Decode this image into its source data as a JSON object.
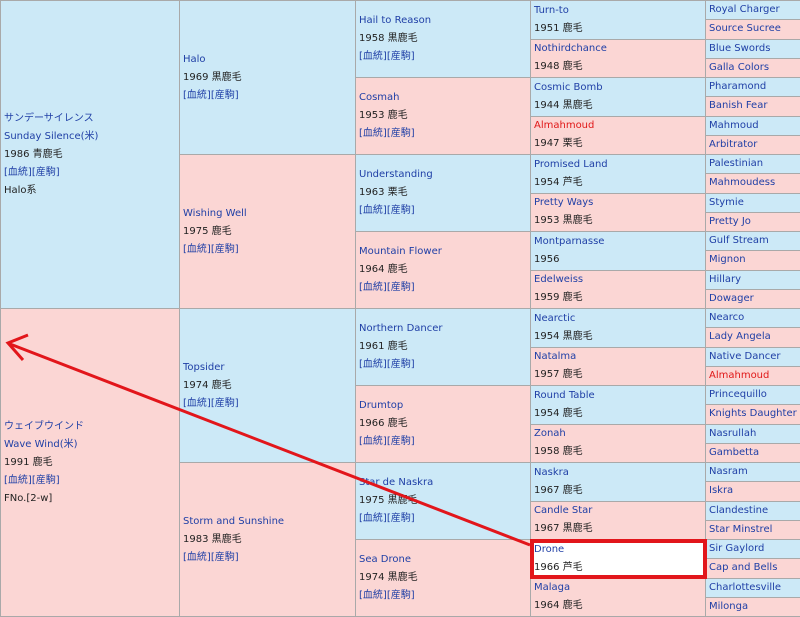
{
  "gen1": [
    {
      "jp": "サンデーサイレンス",
      "en": "Sunday Silence(米)",
      "year": "1986 青鹿毛",
      "links": [
        "[血統]",
        "[産駒]"
      ],
      "extra": "Halo系"
    },
    {
      "jp": "ウェイブウインド",
      "en": "Wave Wind(米)",
      "year": "1991 鹿毛",
      "links": [
        "[血統]",
        "[産駒]"
      ],
      "extra": "FNo.[2-w]"
    }
  ],
  "gen2": [
    {
      "name": "Halo",
      "year": "1969 黒鹿毛",
      "links": [
        "[血統]",
        "[産駒]"
      ]
    },
    {
      "name": "Wishing Well",
      "year": "1975 鹿毛",
      "links": [
        "[血統]",
        "[産駒]"
      ]
    },
    {
      "name": "Topsider",
      "year": "1974 鹿毛",
      "links": [
        "[血統]",
        "[産駒]"
      ]
    },
    {
      "name": "Storm and Sunshine",
      "year": "1983 黒鹿毛",
      "links": [
        "[血統]",
        "[産駒]"
      ]
    }
  ],
  "gen3": [
    {
      "name": "Hail to Reason",
      "year": "1958 黒鹿毛",
      "links": [
        "[血統]",
        "[産駒]"
      ]
    },
    {
      "name": "Cosmah",
      "year": "1953 鹿毛",
      "links": [
        "[血統]",
        "[産駒]"
      ]
    },
    {
      "name": "Understanding",
      "year": "1963 栗毛",
      "links": [
        "[血統]",
        "[産駒]"
      ]
    },
    {
      "name": "Mountain Flower",
      "year": "1964 鹿毛",
      "links": [
        "[血統]",
        "[産駒]"
      ]
    },
    {
      "name": "Northern Dancer",
      "year": "1961 鹿毛",
      "links": [
        "[血統]",
        "[産駒]"
      ]
    },
    {
      "name": "Drumtop",
      "year": "1966 鹿毛",
      "links": [
        "[血統]",
        "[産駒]"
      ]
    },
    {
      "name": "Star de Naskra",
      "year": "1975 黒鹿毛",
      "links": [
        "[血統]",
        "[産駒]"
      ]
    },
    {
      "name": "Sea Drone",
      "year": "1974 黒鹿毛",
      "links": [
        "[血統]",
        "[産駒]"
      ]
    }
  ],
  "gen4": [
    {
      "name": "Turn-to",
      "year": "1951 鹿毛"
    },
    {
      "name": "Nothirdchance",
      "year": "1948 鹿毛"
    },
    {
      "name": "Cosmic Bomb",
      "year": "1944 黒鹿毛"
    },
    {
      "name": "Almahmoud",
      "year": "1947 栗毛"
    },
    {
      "name": "Promised Land",
      "year": "1954 芦毛"
    },
    {
      "name": "Pretty Ways",
      "year": "1953 黒鹿毛"
    },
    {
      "name": "Montparnasse",
      "year": "1956"
    },
    {
      "name": "Edelweiss",
      "year": "1959 鹿毛"
    },
    {
      "name": "Nearctic",
      "year": "1954 黒鹿毛"
    },
    {
      "name": "Natalma",
      "year": "1957 鹿毛"
    },
    {
      "name": "Round Table",
      "year": "1954 鹿毛"
    },
    {
      "name": "Zonah",
      "year": "1958 鹿毛"
    },
    {
      "name": "Naskra",
      "year": "1967 鹿毛"
    },
    {
      "name": "Candle Star",
      "year": "1967 黒鹿毛"
    },
    {
      "name": "Drone",
      "year": "1966 芦毛"
    },
    {
      "name": "Malaga",
      "year": "1964 鹿毛"
    }
  ],
  "gen5": [
    "Royal Charger",
    "Source Sucree",
    "Blue Swords",
    "Galla Colors",
    "Pharamond",
    "Banish Fear",
    "Mahmoud",
    "Arbitrator",
    "Palestinian",
    "Mahmoudess",
    "Stymie",
    "Pretty Jo",
    "Gulf Stream",
    "Mignon",
    "Hillary",
    "Dowager",
    "Nearco",
    "Lady Angela",
    "Native Dancer",
    "Almahmoud",
    "Princequillo",
    "Knights Daughter",
    "Nasrullah",
    "Gambetta",
    "Nasram",
    "Iskra",
    "Clandestine",
    "Star Minstrel",
    "Sir Gaylord",
    "Cap and Bells",
    "Charlottesville",
    "Milonga"
  ],
  "highlight": {
    "red_color": "#e01818",
    "arrow_color": "#e2161b"
  }
}
